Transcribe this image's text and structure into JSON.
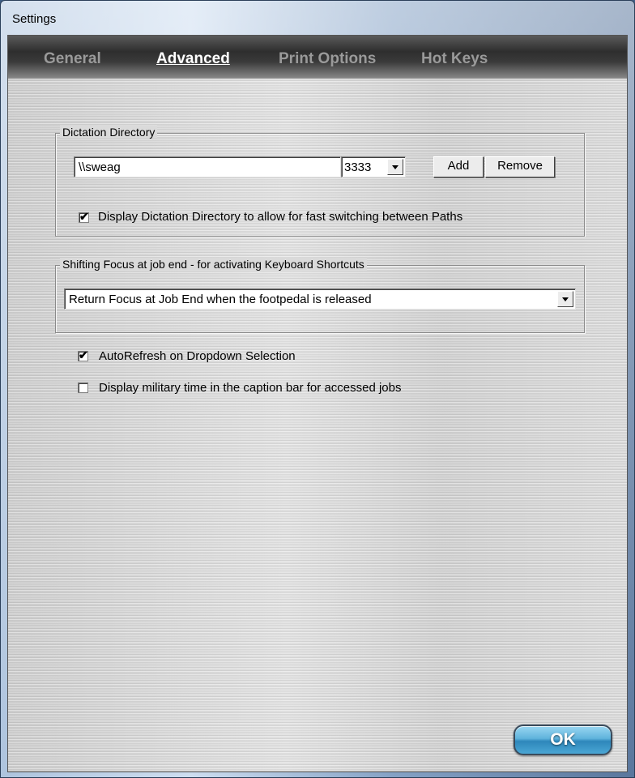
{
  "window": {
    "title": "Settings"
  },
  "tabs": [
    {
      "label": "General",
      "active": false
    },
    {
      "label": "Advanced",
      "active": true
    },
    {
      "label": "Print Options",
      "active": false
    },
    {
      "label": "Hot Keys",
      "active": false
    }
  ],
  "dictation_directory": {
    "legend": "Dictation Directory",
    "path_value": "\\\\sweag",
    "port_value": "3333",
    "add_label": "Add",
    "remove_label": "Remove",
    "display_checkbox_label": "Display Dictation Directory to allow for fast switching between Paths",
    "display_checked": true
  },
  "shifting_focus": {
    "legend": "Shifting Focus at job end - for activating Keyboard Shortcuts",
    "selected_option": "Return Focus at Job End when the footpedal is released"
  },
  "options": {
    "autorefresh_label": "AutoRefresh on Dropdown Selection",
    "autorefresh_checked": true,
    "military_time_label": "Display military time in the caption bar for accessed jobs",
    "military_time_checked": false
  },
  "footer": {
    "ok_label": "OK"
  },
  "icons": {
    "checkmark": "checkmark-icon",
    "dropdown": "chevron-down-icon"
  },
  "colors": {
    "ok_button": "#2e87bb",
    "tab_active": "#ffffff",
    "tab_inactive": "#9a9a9a",
    "tab_bar": "#2e2e2e"
  }
}
